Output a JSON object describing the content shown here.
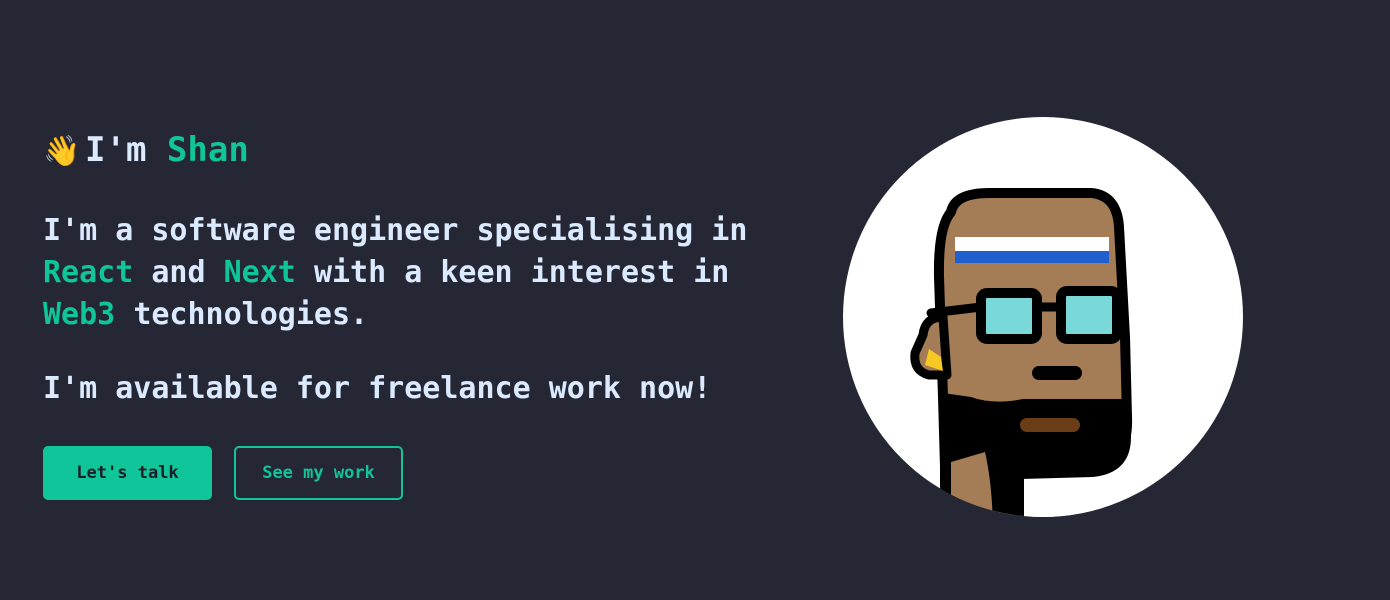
{
  "hero": {
    "greeting": {
      "emoji": "👋",
      "prefix": "I'm",
      "name": "Shan"
    },
    "bio": {
      "part1": "I'm a software engineer specialising in",
      "highlight1": "React",
      "part2": "and",
      "highlight2": "Next",
      "part3": "with a keen interest in",
      "highlight3": "Web3",
      "part4": "technologies."
    },
    "availability": "I'm available for freelance work now!",
    "buttons": {
      "primary_label": "Let's talk",
      "secondary_label": "See my work"
    },
    "avatar": {
      "icon": "pixel-avatar-icon"
    }
  },
  "colors": {
    "background": "#252735",
    "accent": "#10c59a",
    "text": "#dbeafe"
  }
}
